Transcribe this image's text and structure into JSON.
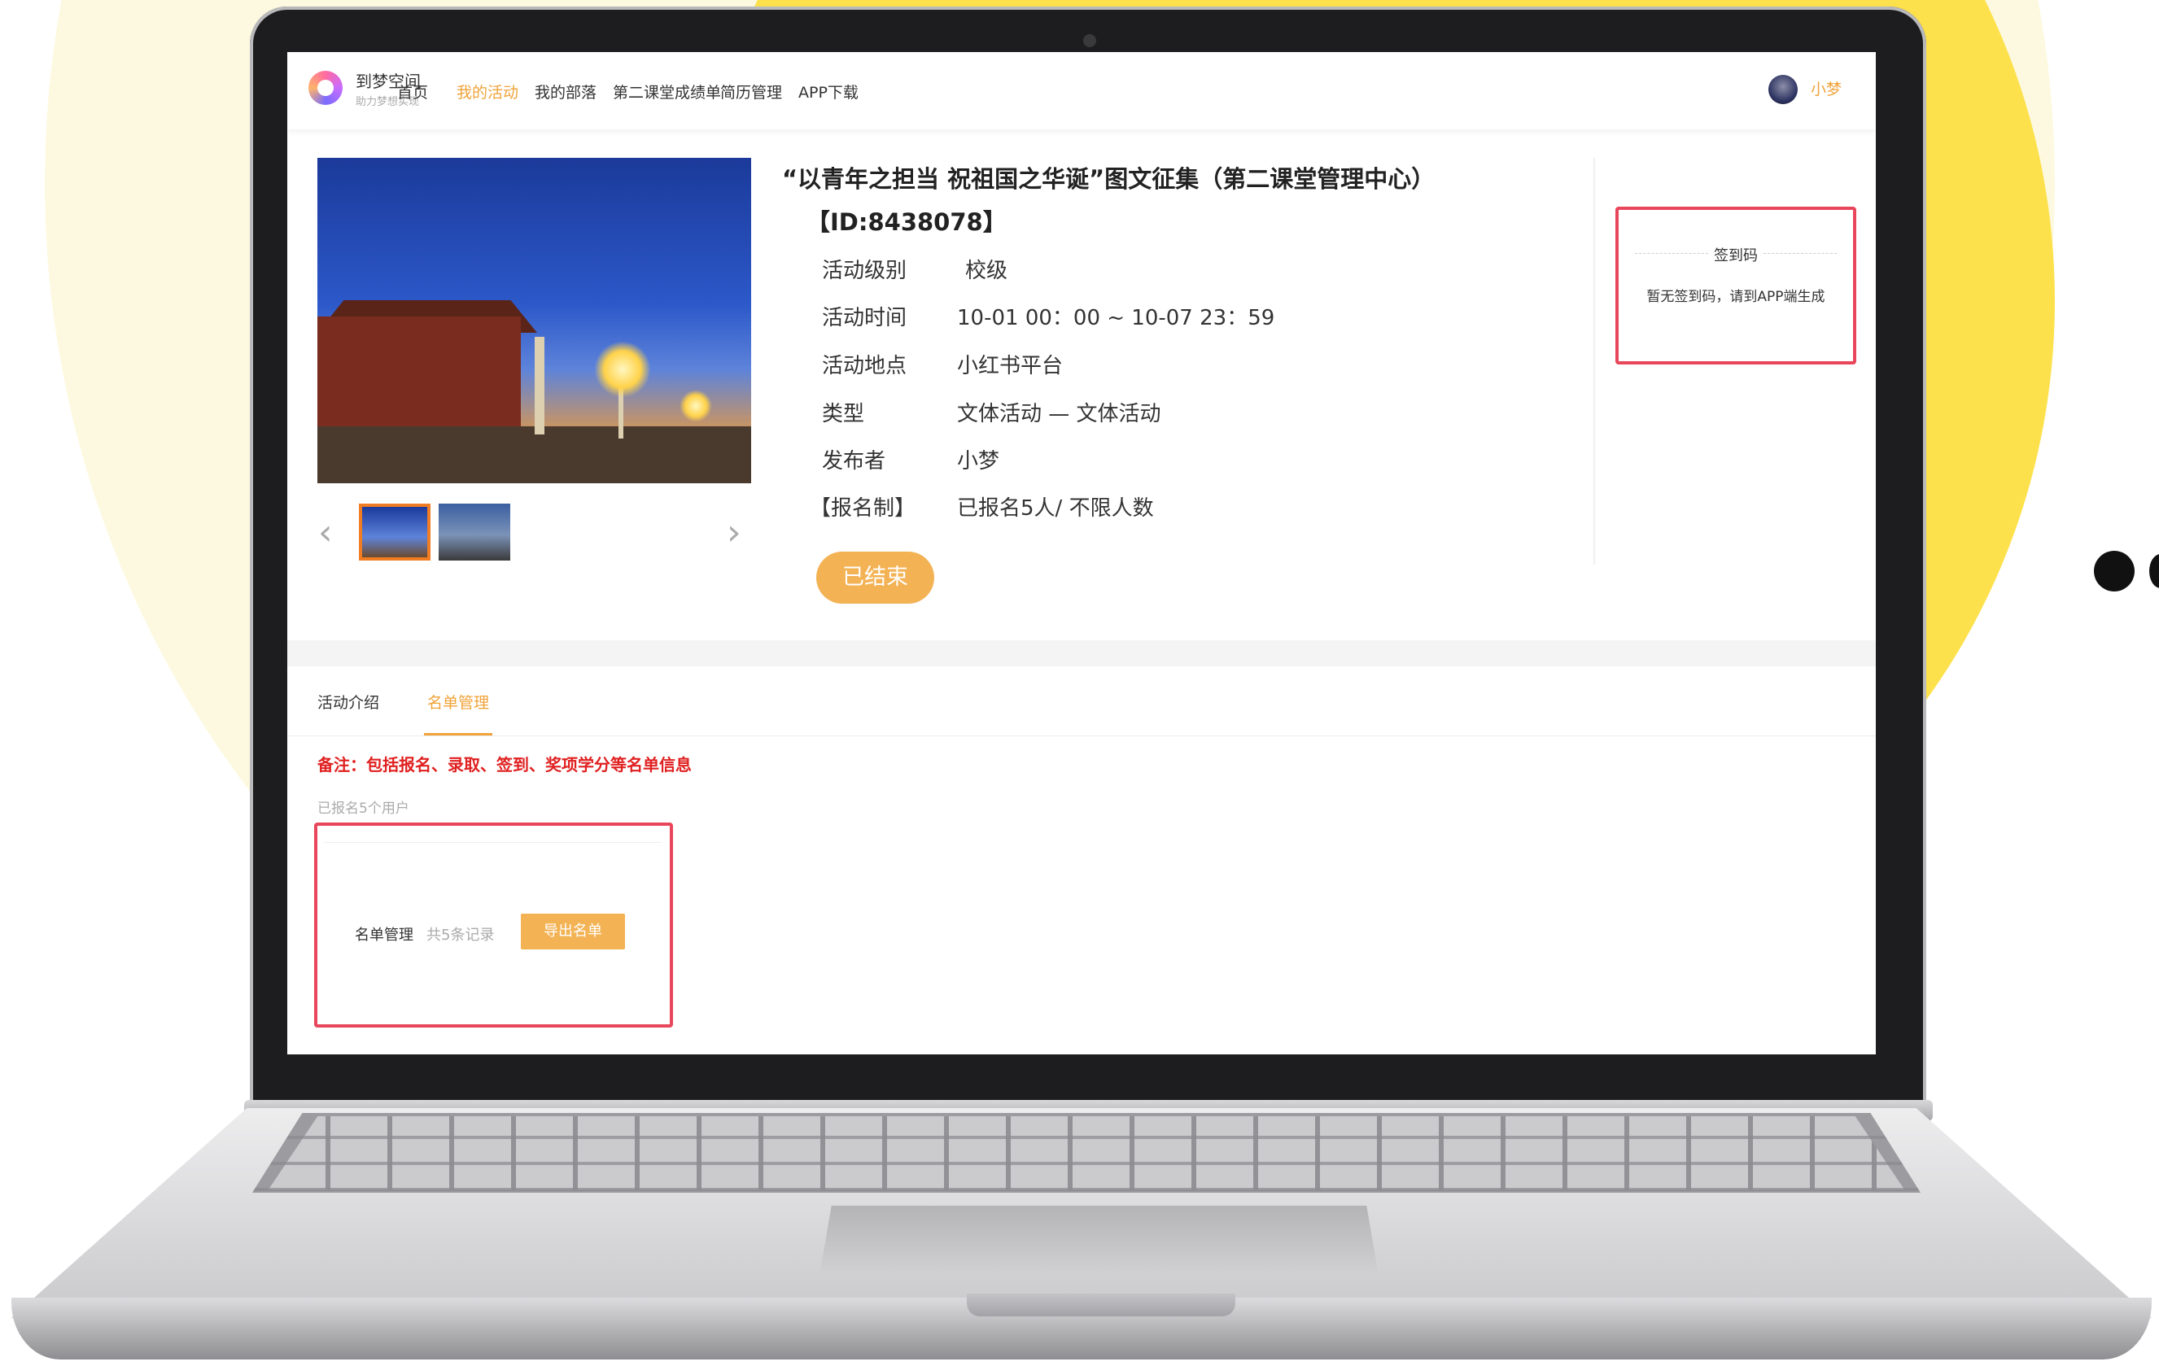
{
  "nav": {
    "logo_name": "到梦空间",
    "logo_slogan": "助力梦想实现",
    "items": [
      "首页",
      "我的活动",
      "我的部落",
      "第二课堂成绩单",
      "简历管理",
      "APP下载"
    ],
    "active_item": "我的活动",
    "user_name": "小梦"
  },
  "activity": {
    "title": "“以青年之担当 祝祖国之华诞”图文征集（第二课堂管理中心）【ID:8438078】",
    "rows": [
      {
        "label": "活动级别",
        "value": "校级"
      },
      {
        "label": "活动时间",
        "value": "10-01 00：00 ~ 10-07 23：59"
      },
      {
        "label": "活动地点",
        "value": "小红书平台"
      },
      {
        "label": "类型",
        "value": "文体活动 — 文体活动"
      },
      {
        "label": "发布者",
        "value": "小梦"
      },
      {
        "label": "【报名制】",
        "value": "已报名5人/ 不限人数"
      }
    ],
    "status_button": "已结束"
  },
  "signin": {
    "title": "签到码",
    "message": "暂无签到码，请到APP端生成"
  },
  "tabs": {
    "items": [
      "活动介绍",
      "名单管理"
    ],
    "active": "名单管理"
  },
  "roster": {
    "note": "备注：包括报名、录取、签到、奖项学分等名单信息",
    "registered_text": "已报名5个用户",
    "label": "名单管理",
    "record_count": "共5条记录",
    "export_button": "导出名单"
  },
  "colors": {
    "accent": "#f0a33a",
    "button": "#f3b254",
    "highlight_border": "#e8465b",
    "note_red": "#e02020",
    "background_yellow": "#fde14c"
  },
  "icons": [
    "logo-icon",
    "avatar",
    "chevron-left-icon",
    "chevron-right-icon"
  ]
}
